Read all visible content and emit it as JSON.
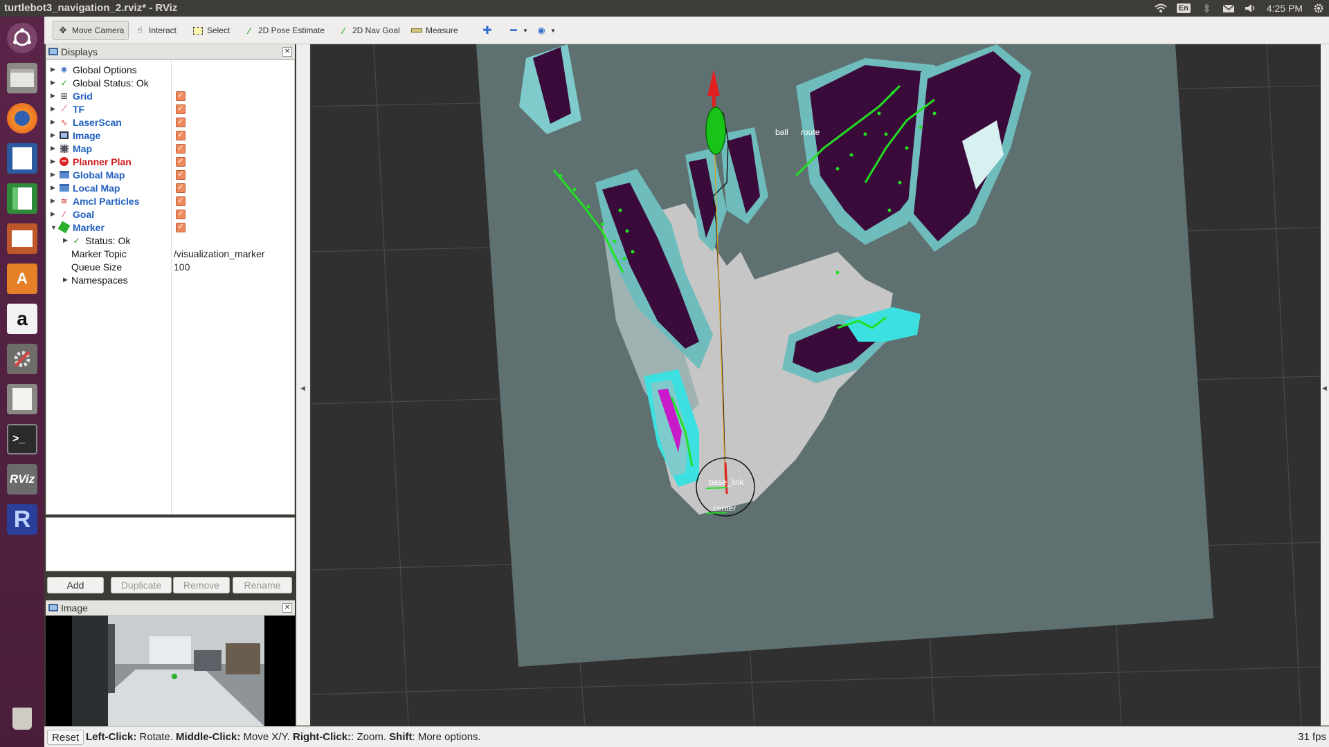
{
  "window": {
    "title": "turtlebot3_navigation_2.rviz* - RViz"
  },
  "tray": {
    "lang": "En",
    "time": "4:25 PM"
  },
  "launcher": {
    "icons": [
      "ubuntu-icon",
      "files-icon",
      "firefox-icon",
      "writer-icon",
      "calc-icon",
      "impress-icon",
      "software-center-icon",
      "amazon-icon",
      "settings-icon",
      "text-editor-icon",
      "terminal-icon",
      "rviz-icon",
      "r-icon",
      "trash-icon"
    ]
  },
  "toolbar": {
    "move_camera": "Move Camera",
    "interact": "Interact",
    "select": "Select",
    "pose_estimate": "2D Pose Estimate",
    "nav_goal": "2D Nav Goal",
    "measure": "Measure"
  },
  "displays": {
    "title": "Displays",
    "items": [
      {
        "label": "Global Options",
        "style": "black",
        "icon": "gear-icon"
      },
      {
        "label": "Global Status: Ok",
        "style": "black",
        "icon": "check-icon"
      },
      {
        "label": "Grid",
        "style": "blue",
        "icon": "grid-icon",
        "checked": true
      },
      {
        "label": "TF",
        "style": "blue",
        "icon": "tf-icon",
        "checked": true
      },
      {
        "label": "LaserScan",
        "style": "blue",
        "icon": "laser-icon",
        "checked": true
      },
      {
        "label": "Image",
        "style": "blue",
        "icon": "image-icon",
        "checked": true
      },
      {
        "label": "Map",
        "style": "blue",
        "icon": "map-icon",
        "checked": true
      },
      {
        "label": "Planner Plan",
        "style": "red",
        "icon": "error-icon",
        "checked": true
      },
      {
        "label": "Global Map",
        "style": "blue",
        "icon": "folder-icon",
        "checked": true
      },
      {
        "label": "Local Map",
        "style": "blue",
        "icon": "folder-icon",
        "checked": true
      },
      {
        "label": "Amcl Particles",
        "style": "blue",
        "icon": "particles-icon",
        "checked": true
      },
      {
        "label": "Goal",
        "style": "blue",
        "icon": "goal-icon",
        "checked": true
      },
      {
        "label": "Marker",
        "style": "blue",
        "icon": "marker-icon",
        "checked": true
      }
    ],
    "marker_children": {
      "status": "Status: Ok",
      "topic_label": "Marker Topic",
      "topic_value": "/visualization_marker",
      "queue_label": "Queue Size",
      "queue_value": "100",
      "namespaces": "Namespaces"
    },
    "buttons": {
      "add": "Add",
      "duplicate": "Duplicate",
      "remove": "Remove",
      "rename": "Rename"
    }
  },
  "image_panel": {
    "title": "Image"
  },
  "view": {
    "labels": {
      "ball": "ball",
      "route": "route",
      "base_link": "base_link",
      "center": "center"
    }
  },
  "statusbar": {
    "reset": "Reset",
    "hint_left": "Left-Click:",
    "hint_left_txt": " Rotate. ",
    "hint_mid": "Middle-Click:",
    "hint_mid_txt": " Move X/Y. ",
    "hint_right": "Right-Click:",
    "hint_right_txt": ": Zoom. ",
    "hint_shift": "Shift",
    "hint_shift_txt": ": More options.",
    "fps": "31 fps"
  }
}
